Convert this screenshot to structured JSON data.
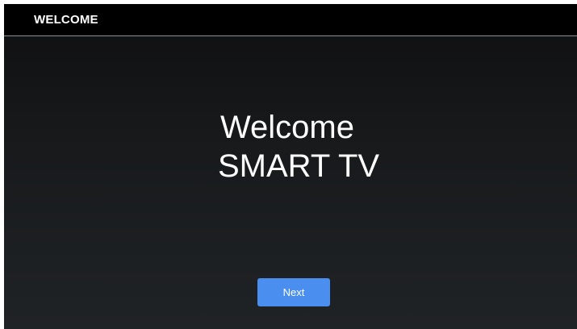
{
  "header": {
    "title": "WELCOME"
  },
  "main": {
    "welcome_text": "Welcome",
    "product_text": "SMART TV"
  },
  "actions": {
    "next_label": "Next"
  },
  "colors": {
    "titlebar_bg": "#000000",
    "screen_bg_top": "#0f0f10",
    "screen_bg_bottom": "#202326",
    "accent": "#4a8ef0",
    "text": "#ffffff"
  }
}
